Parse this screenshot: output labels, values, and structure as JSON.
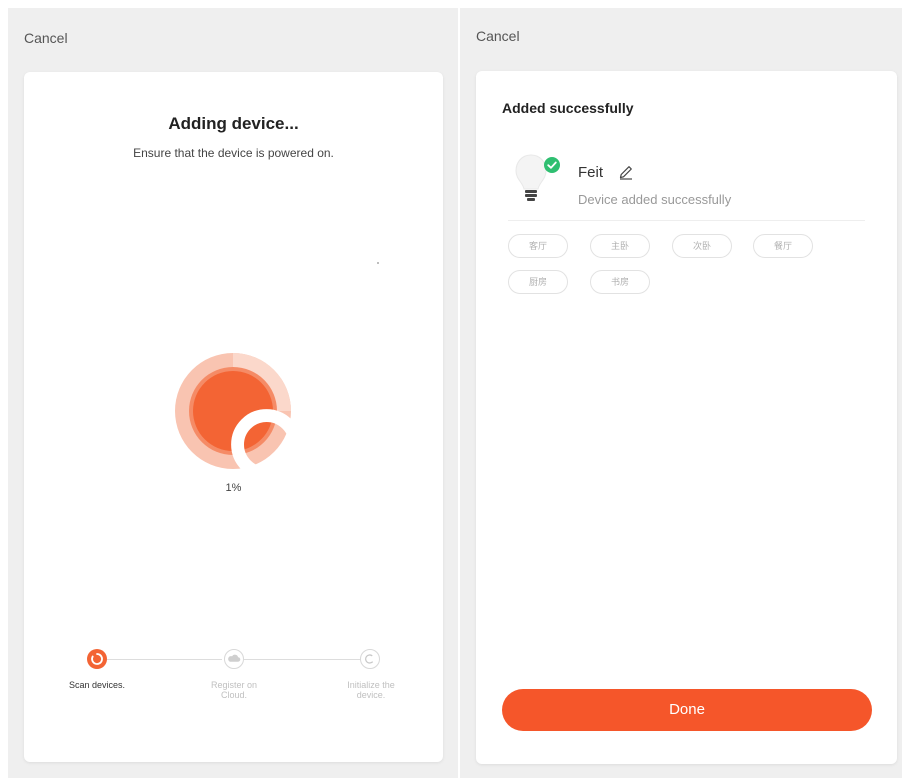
{
  "left_screen": {
    "cancel_label": "Cancel",
    "title": "Adding device...",
    "subtitle": "Ensure that the device is powered on.",
    "progress_percent": 1,
    "progress_text": "1%",
    "steps": [
      {
        "label_line1": "Scan devices.",
        "label_line2": "",
        "state": "active",
        "icon": "spinner-icon"
      },
      {
        "label_line1": "Register on",
        "label_line2": "Cloud.",
        "state": "inactive",
        "icon": "cloud-icon"
      },
      {
        "label_line1": "Initialize the",
        "label_line2": "device.",
        "state": "inactive",
        "icon": "refresh-icon"
      }
    ],
    "colors": {
      "accent": "#f36434",
      "ring_outer": "#f9b8a0",
      "ring_inner": "#f58b66"
    }
  },
  "right_screen": {
    "cancel_label": "Cancel",
    "title": "Added successfully",
    "device": {
      "name": "Feit",
      "status": "Device added successfully",
      "icon": "light-bulb-icon",
      "badge_icon": "check-icon"
    },
    "rooms": [
      "客厅",
      "主卧",
      "次卧",
      "餐厅",
      "厨房",
      "书房"
    ],
    "done_label": "Done",
    "colors": {
      "accent": "#f5562a",
      "success": "#2fbf71"
    }
  }
}
